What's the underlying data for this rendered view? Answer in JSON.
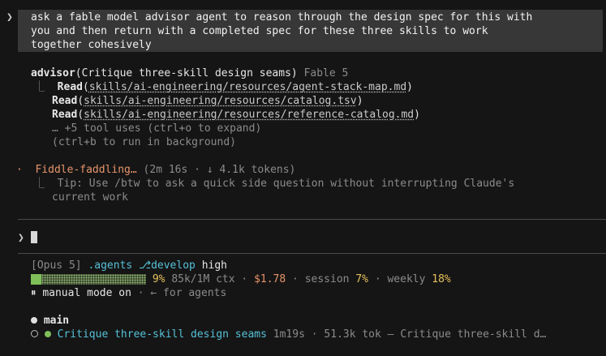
{
  "prompt": {
    "chevron": "❯",
    "lines": [
      "ask a fable model advisor agent to reason through the design spec for this with",
      "you and then return with a completed spec for these three skills to work",
      "together cohesively"
    ]
  },
  "advisor": {
    "name": "advisor",
    "task": "(Critique three-skill design seams)",
    "model": "Fable 5",
    "branch_glyph": "⎿",
    "reads": [
      {
        "verb": "Read",
        "path": "skills/ai-engineering/resources/agent-stack-map.md"
      },
      {
        "verb": "Read",
        "path": "skills/ai-engineering/resources/catalog.tsv"
      },
      {
        "verb": "Read",
        "path": "skills/ai-engineering/resources/reference-catalog.md"
      }
    ],
    "more": "… +5 tool uses (ctrl+o to expand)",
    "background_hint": "(ctrl+b to run in background)"
  },
  "status": {
    "bullet": "·",
    "label": "Fiddle-faddling…",
    "meta": "(2m 16s · ↓ 4.1k tokens)",
    "tip_line1": "Tip: Use /btw to ask a quick side question without interrupting Claude's",
    "tip_line2": "current work"
  },
  "input": {
    "chevron": "❯"
  },
  "footer": {
    "model": "[Opus 5]",
    "dir": ".agents",
    "branch_icon": "⎇",
    "branch": "develop",
    "effort": "high",
    "ctx_percent_text": "9%",
    "ctx_percent_value": 9,
    "ctx": "85k/1M ctx",
    "sep": "·",
    "cost": "$1.78",
    "session_label": "session",
    "session_value": "7%",
    "weekly_label": "weekly",
    "weekly_value": "18%",
    "mode_icon": "⏸",
    "mode": "manual mode on",
    "mode_hint": "← for agents"
  },
  "agents": {
    "main_label": "main",
    "task_title": "Critique three-skill design seams",
    "task_time": "1m19s",
    "task_tokens": "51.3k tok",
    "task_dash": "—",
    "task_desc": "Critique three-skill d…"
  },
  "colors": {
    "background": "#151515",
    "prompt_bg": "#373737",
    "orange": "#e8956a",
    "green": "#86c361",
    "yellow": "#e7c15a",
    "cyan": "#56c1d8"
  }
}
